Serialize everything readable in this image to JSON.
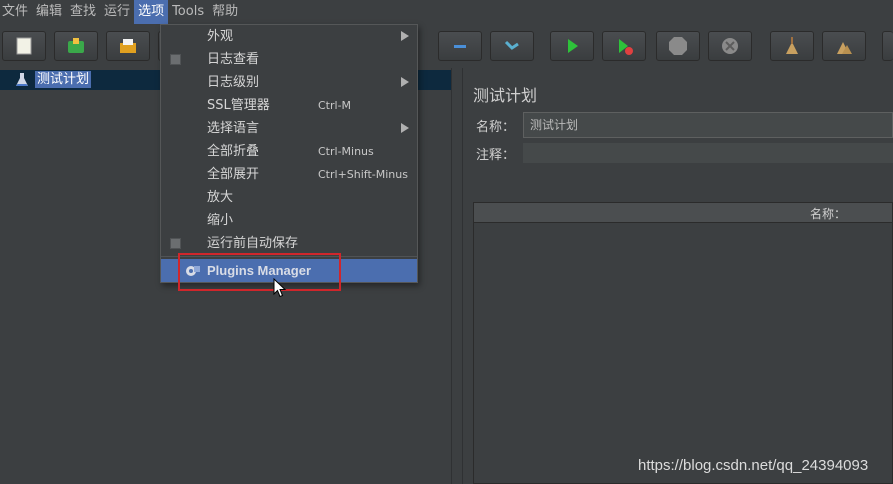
{
  "menubar": {
    "items": [
      "文件",
      "编辑",
      "查找",
      "运行",
      "选项",
      "Tools",
      "帮助"
    ],
    "active_index": 4
  },
  "toolbar": {
    "buttons": [
      {
        "name": "new-icon",
        "color": "#f2f2e6"
      },
      {
        "name": "templates-icon",
        "color": "#3aa84a"
      },
      {
        "name": "open-icon",
        "color": "#e0a020"
      },
      {
        "name": "collapse-icon",
        "color": "#4a8fd8"
      },
      {
        "name": "toggle-icon",
        "color": "#5ab0d0"
      },
      {
        "name": "start-icon",
        "color": "#2ec23a"
      },
      {
        "name": "start-no-pause-icon",
        "color": "#2ec23a"
      },
      {
        "name": "stop-icon",
        "color": "#8a8a8a"
      },
      {
        "name": "shutdown-icon",
        "color": "#8a8a8a"
      },
      {
        "name": "clear-icon",
        "color": "#c8a060"
      },
      {
        "name": "clear-all-icon",
        "color": "#c8a060"
      },
      {
        "name": "search-icon",
        "color": "#d0d0d0"
      }
    ]
  },
  "tree": {
    "root_label": "测试计划"
  },
  "right_pane": {
    "title": "测试计划",
    "name_label": "名称：",
    "name_value": "测试计划",
    "note_label": "注释：",
    "table_header": "名称："
  },
  "options_menu": {
    "items": [
      {
        "label": "外观",
        "shortcut": "",
        "submenu": true,
        "checkbox": false
      },
      {
        "label": "日志查看",
        "shortcut": "",
        "submenu": false,
        "checkbox": true
      },
      {
        "label": "日志级别",
        "shortcut": "",
        "submenu": true,
        "checkbox": false
      },
      {
        "label": "SSL管理器",
        "shortcut": "Ctrl-M",
        "submenu": false,
        "checkbox": false
      },
      {
        "label": "选择语言",
        "shortcut": "",
        "submenu": true,
        "checkbox": false
      },
      {
        "label": "全部折叠",
        "shortcut": "Ctrl-Minus",
        "submenu": false,
        "checkbox": false
      },
      {
        "label": "全部展开",
        "shortcut": "Ctrl+Shift-Minus",
        "submenu": false,
        "checkbox": false
      },
      {
        "label": "放大",
        "shortcut": "",
        "submenu": false,
        "checkbox": false
      },
      {
        "label": "缩小",
        "shortcut": "",
        "submenu": false,
        "checkbox": false
      },
      {
        "label": "运行前自动保存",
        "shortcut": "",
        "submenu": false,
        "checkbox": true
      }
    ],
    "plugins_label": "Plugins Manager"
  },
  "watermark": "https://blog.csdn.net/qq_24394093",
  "colors": {
    "accent": "#4b6eaf",
    "highlight_box": "#d0262b",
    "background": "#3c3f41"
  }
}
